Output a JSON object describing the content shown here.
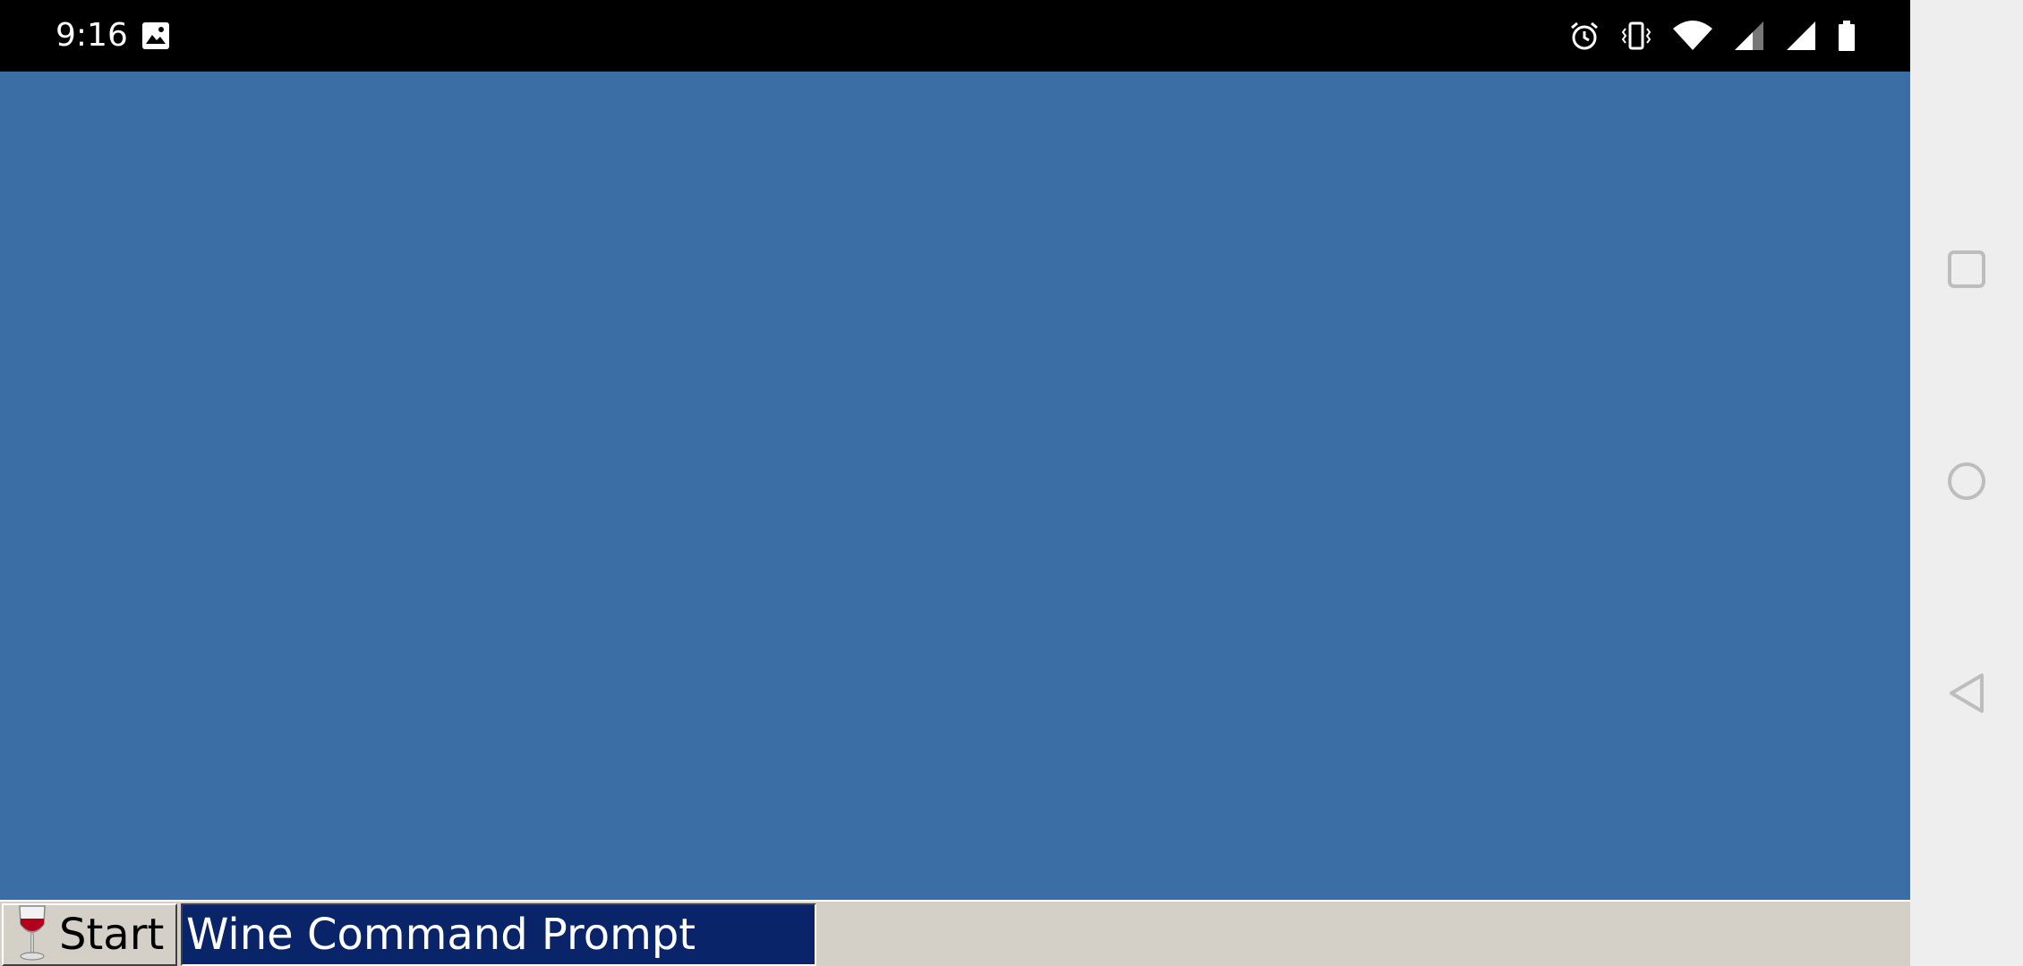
{
  "status_bar": {
    "time": "9:16",
    "icons": [
      "gallery-icon",
      "alarm-icon",
      "vibrate-icon",
      "wifi-icon",
      "signal-icon",
      "signal-icon",
      "battery-icon"
    ]
  },
  "desktop": {
    "background_color": "#3b6ea5"
  },
  "taskbar": {
    "start_label": "Start",
    "start_icon": "wine-glass-icon",
    "tasks": [
      {
        "label": "Wine Command Prompt",
        "active": true
      }
    ]
  },
  "nav_bar": {
    "buttons": [
      "recent-apps-icon",
      "home-icon",
      "back-icon"
    ]
  },
  "colors": {
    "taskbar": "#d4d0c8",
    "active_task": "#0a246a",
    "status_bar": "#000000",
    "nav_bar": "#eeeeee"
  }
}
